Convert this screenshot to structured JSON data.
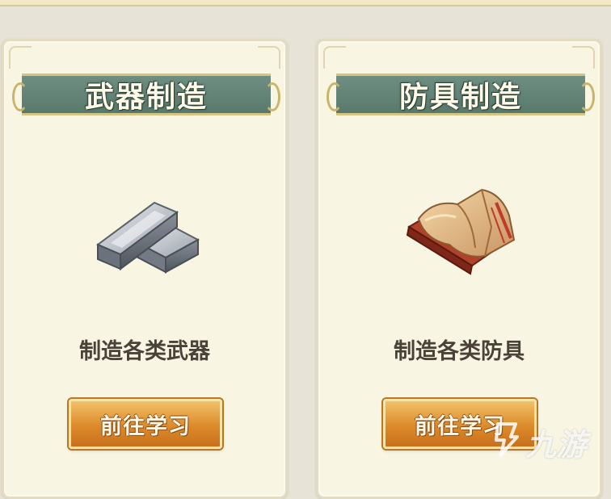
{
  "cards": [
    {
      "title": "武器制造",
      "description": "制造各类武器",
      "button_label": "前往学习",
      "icon": "iron-ingot-icon"
    },
    {
      "title": "防具制造",
      "description": "制造各类防具",
      "button_label": "前往学习",
      "icon": "cloth-bolt-icon"
    }
  ],
  "watermark": {
    "text": "九游",
    "icon": "nine-game-logo-icon"
  },
  "colors": {
    "banner": "#6f8e82",
    "button": "#dc8a2a",
    "card_bg": "#f8f5e3"
  }
}
